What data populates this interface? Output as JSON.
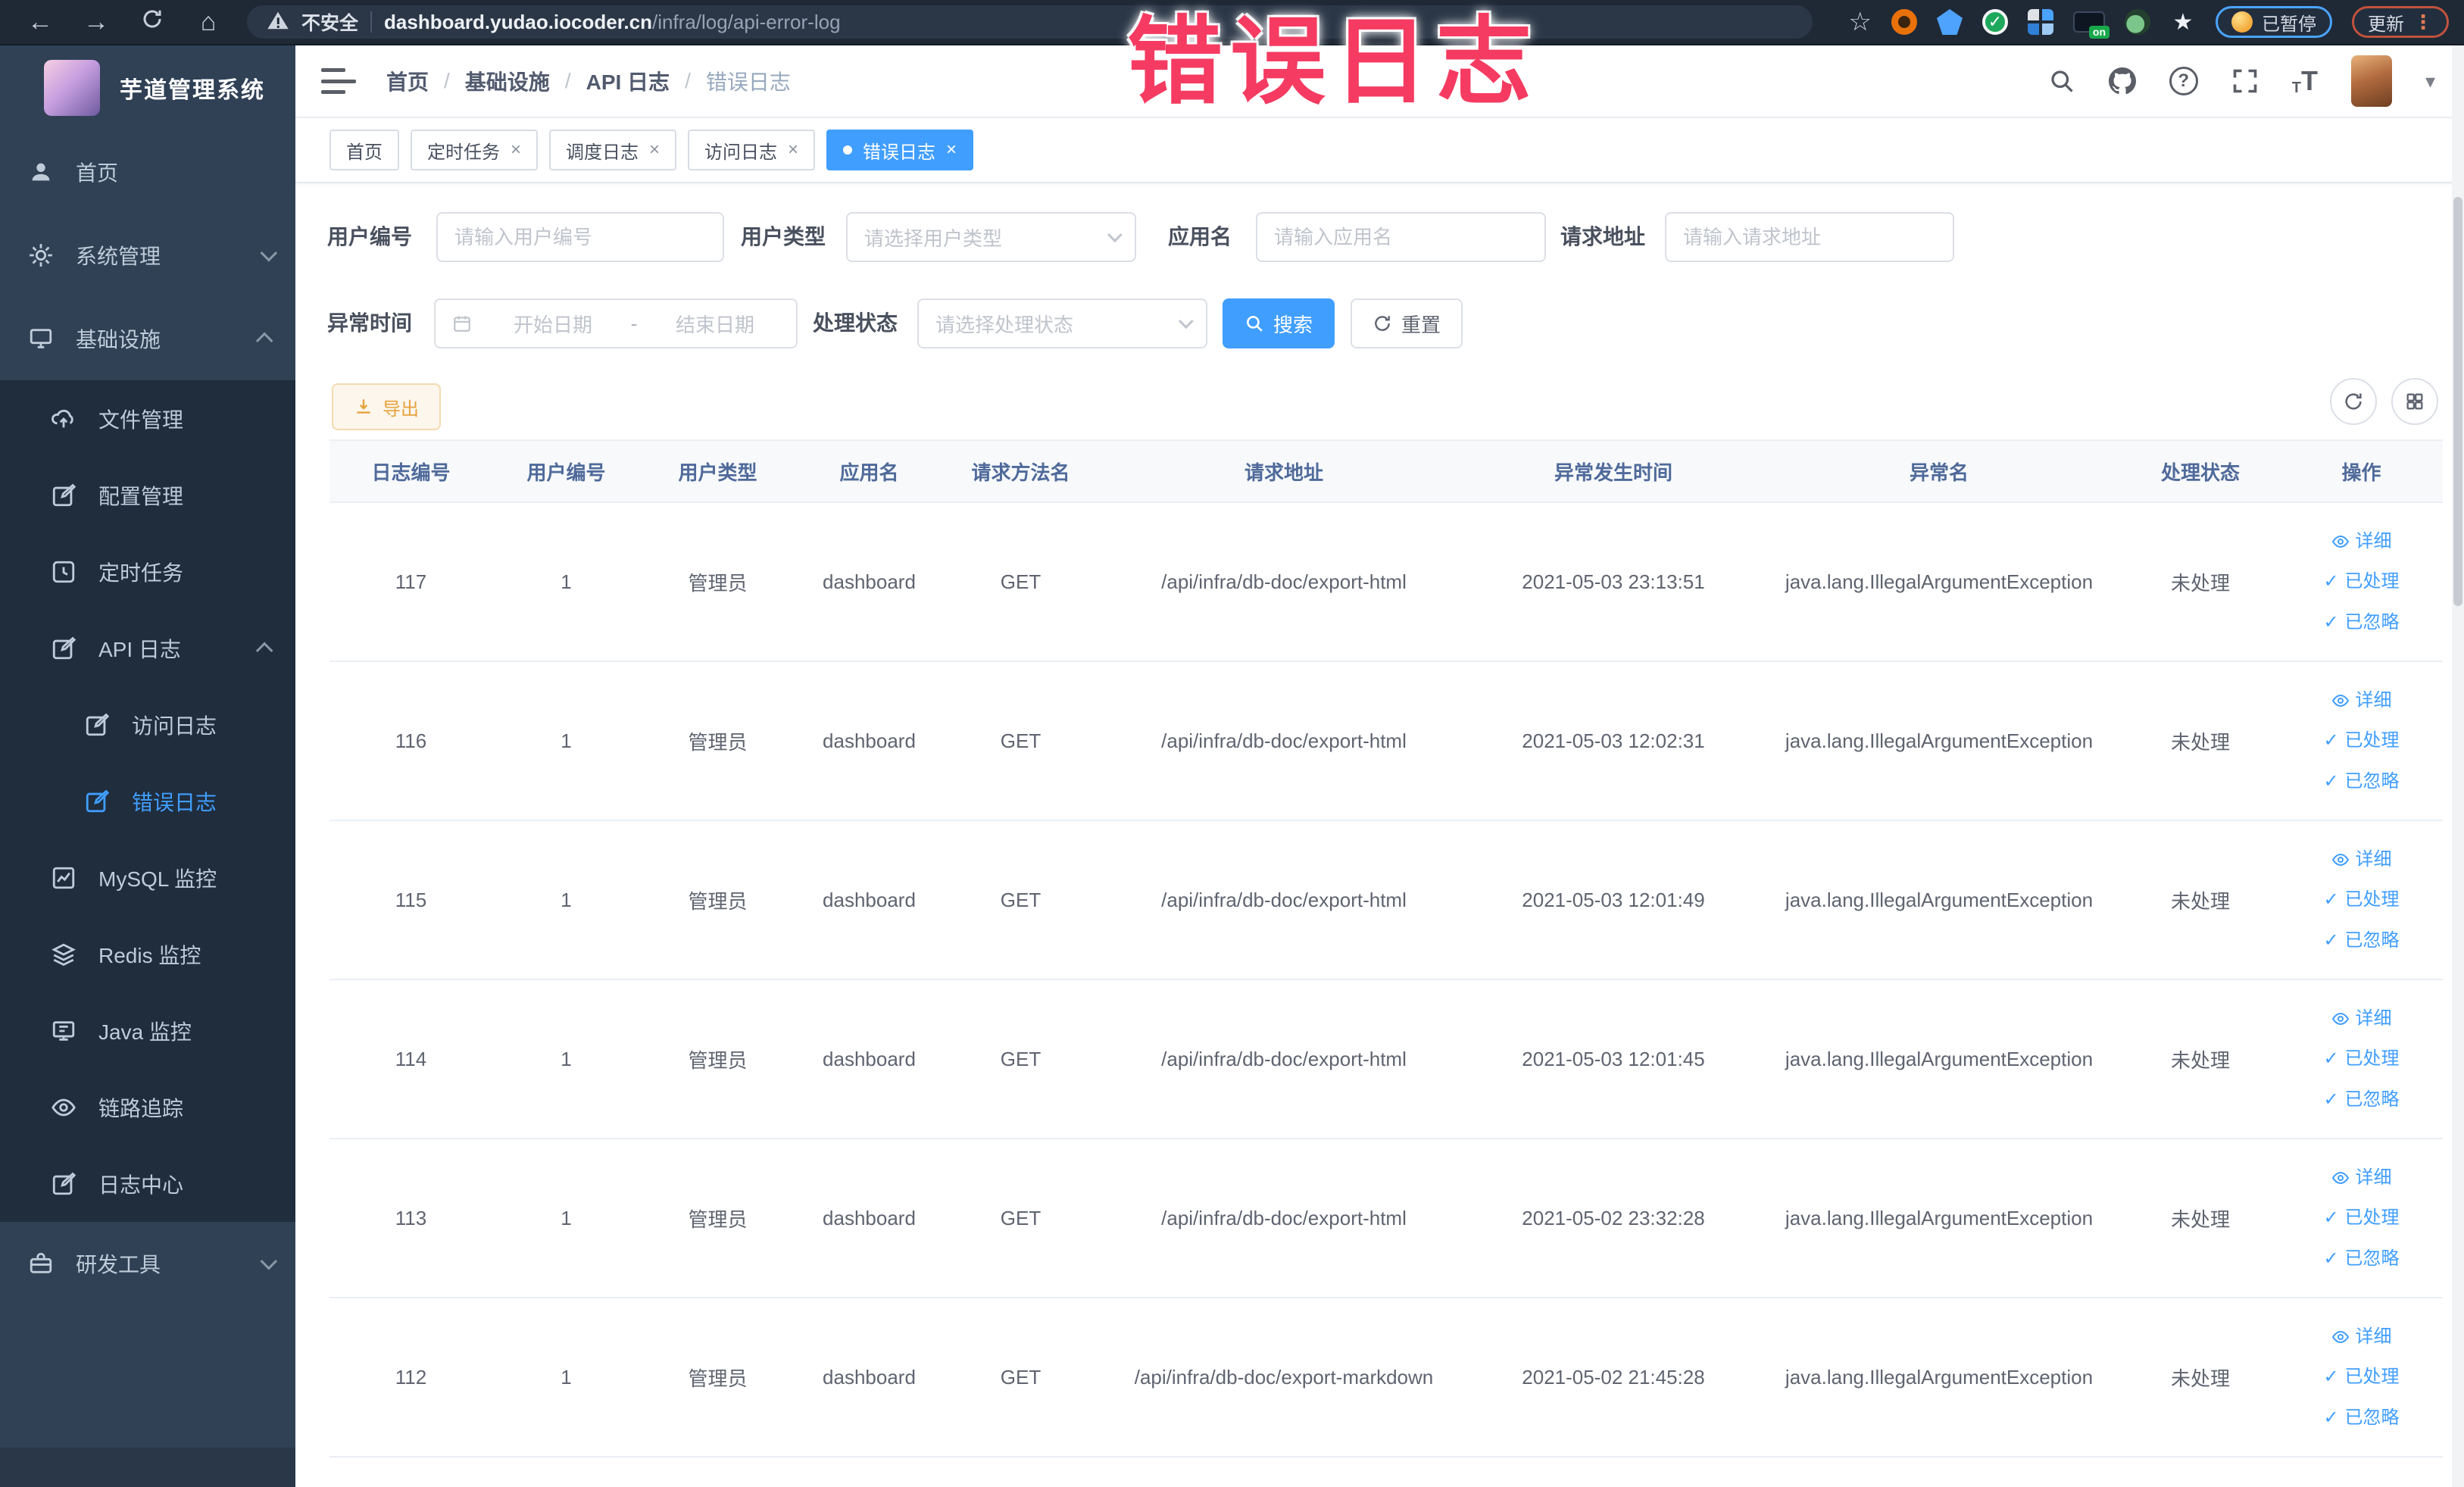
{
  "icons": {
    "back": "←",
    "forward": "→",
    "home": "⌂",
    "star": "☆",
    "caret_down": "▾",
    "close": "×",
    "check": "✓",
    "dots_v": "⋮",
    "question": "?",
    "font_t": "T",
    "dot": "",
    "sep": "/"
  },
  "browser": {
    "security_label": "不安全",
    "url_domain": "dashboard.yudao.iocoder.cn",
    "url_path": "/infra/log/api-error-log",
    "ext_on_label": "on",
    "paused_badge": "已暂停",
    "update_badge": "更新"
  },
  "annotation": {
    "text": "错误日志"
  },
  "sidebar": {
    "title": "芋道管理系统",
    "items": {
      "home": "首页",
      "system": "系统管理",
      "infra": "基础设施",
      "file": "文件管理",
      "config": "配置管理",
      "job": "定时任务",
      "apilog": "API 日志",
      "accesslog": "访问日志",
      "errorlog": "错误日志",
      "mysql": "MySQL 监控",
      "redis": "Redis 监控",
      "java": "Java 监控",
      "trace": "链路追踪",
      "logcenter": "日志中心",
      "devtool": "研发工具"
    }
  },
  "header": {
    "breadcrumb": [
      "首页",
      "基础设施",
      "API 日志",
      "错误日志"
    ]
  },
  "tabs": [
    "首页",
    "定时任务",
    "调度日志",
    "访问日志",
    "错误日志"
  ],
  "filters": {
    "user_id_label": "用户编号",
    "user_id_placeholder": "请输入用户编号",
    "user_type_label": "用户类型",
    "user_type_placeholder": "请选择用户类型",
    "app_name_label": "应用名",
    "app_name_placeholder": "请输入应用名",
    "request_url_label": "请求地址",
    "request_url_placeholder": "请输入请求地址",
    "exception_time_label": "异常时间",
    "start_placeholder": "开始日期",
    "range_separator": "-",
    "end_placeholder": "结束日期",
    "process_status_label": "处理状态",
    "process_status_placeholder": "请选择处理状态",
    "search_label": "搜索",
    "reset_label": "重置"
  },
  "toolbar": {
    "export_label": "导出"
  },
  "table": {
    "columns": [
      "日志编号",
      "用户编号",
      "用户类型",
      "应用名",
      "请求方法名",
      "请求地址",
      "异常发生时间",
      "异常名",
      "处理状态",
      "操作"
    ],
    "action_labels": [
      "详细",
      "已处理",
      "已忽略"
    ],
    "rows": [
      {
        "id": "117",
        "user_id": "1",
        "user_type": "管理员",
        "app": "dashboard",
        "method": "GET",
        "url": "/api/infra/db-doc/export-html",
        "time": "2021-05-03 23:13:51",
        "exception": "java.lang.IllegalArgumentException",
        "status": "未处理"
      },
      {
        "id": "116",
        "user_id": "1",
        "user_type": "管理员",
        "app": "dashboard",
        "method": "GET",
        "url": "/api/infra/db-doc/export-html",
        "time": "2021-05-03 12:02:31",
        "exception": "java.lang.IllegalArgumentException",
        "status": "未处理"
      },
      {
        "id": "115",
        "user_id": "1",
        "user_type": "管理员",
        "app": "dashboard",
        "method": "GET",
        "url": "/api/infra/db-doc/export-html",
        "time": "2021-05-03 12:01:49",
        "exception": "java.lang.IllegalArgumentException",
        "status": "未处理"
      },
      {
        "id": "114",
        "user_id": "1",
        "user_type": "管理员",
        "app": "dashboard",
        "method": "GET",
        "url": "/api/infra/db-doc/export-html",
        "time": "2021-05-03 12:01:45",
        "exception": "java.lang.IllegalArgumentException",
        "status": "未处理"
      },
      {
        "id": "113",
        "user_id": "1",
        "user_type": "管理员",
        "app": "dashboard",
        "method": "GET",
        "url": "/api/infra/db-doc/export-html",
        "time": "2021-05-02 23:32:28",
        "exception": "java.lang.IllegalArgumentException",
        "status": "未处理"
      },
      {
        "id": "112",
        "user_id": "1",
        "user_type": "管理员",
        "app": "dashboard",
        "method": "GET",
        "url": "/api/infra/db-doc/export-markdown",
        "time": "2021-05-02 21:45:28",
        "exception": "java.lang.IllegalArgumentException",
        "status": "未处理"
      }
    ]
  }
}
